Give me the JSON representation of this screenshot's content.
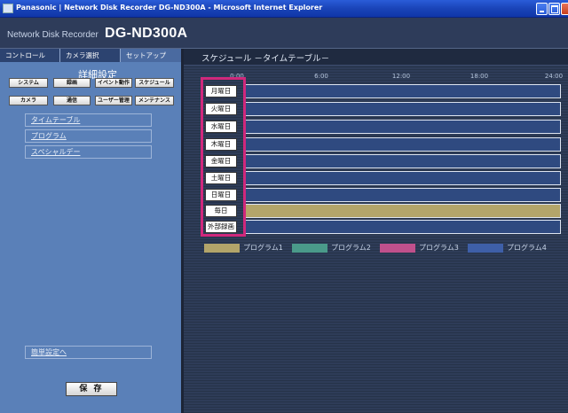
{
  "window": {
    "title": "Panasonic | Network Disk Recorder DG-ND300A - Microsoft Internet Explorer"
  },
  "brand": {
    "subtitle": "Network Disk Recorder",
    "model": "DG-ND300A"
  },
  "tabs": [
    "コントロール",
    "カメラ選択",
    "セットアップ"
  ],
  "left_panel": {
    "section_title": "詳細設定",
    "buttons_row1": [
      "システム",
      "録画",
      "イベント動作",
      "スケジュール"
    ],
    "buttons_row2": [
      "カメラ",
      "通信",
      "ユーザー管理",
      "メンテナンス"
    ],
    "links": [
      "タイムテーブル",
      "プログラム",
      "スペシャルデー"
    ],
    "quick_link": "簡単設定へ",
    "save_label": "保 存"
  },
  "schedule": {
    "title": "スケジュール －タイムテーブル－",
    "time_labels": [
      "0:00",
      "6:00",
      "12:00",
      "18:00",
      "24:00"
    ],
    "days": [
      "月曜日",
      "火曜日",
      "水曜日",
      "木曜日",
      "金曜日",
      "土曜日",
      "日曜日",
      "毎日",
      "外部録画"
    ],
    "colors": {
      "program1": "#b3a56a",
      "program2": "#4a9a8a",
      "program3": "#c0508c",
      "program4": "#3e5fa8",
      "empty_row": "#2f4a80",
      "highlight": "#d0287c"
    },
    "legend": [
      "プログラム1",
      "プログラム2",
      "プログラム3",
      "プログラム4"
    ]
  }
}
